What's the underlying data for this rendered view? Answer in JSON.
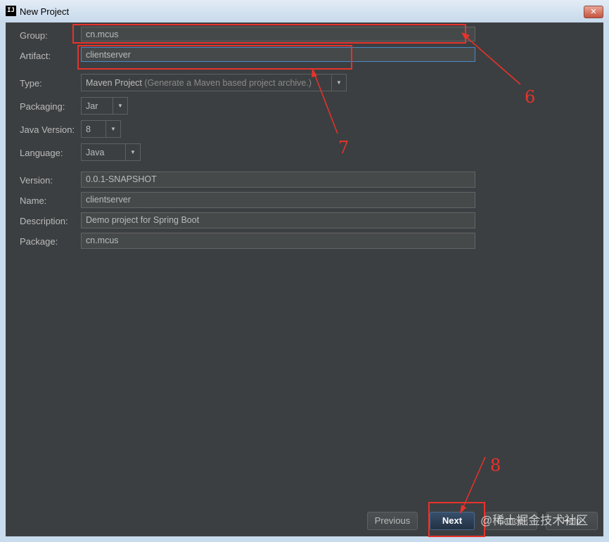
{
  "window": {
    "app_icon_text": "IJ",
    "title": "New Project",
    "close_symbol": "✕"
  },
  "form": {
    "group": {
      "label": "Group:",
      "value": "cn.mcus"
    },
    "artifact": {
      "label": "Artifact:",
      "value": "clientserver"
    },
    "type": {
      "label": "Type:",
      "value": "Maven Project",
      "hint": "(Generate a Maven based project archive.)"
    },
    "packaging": {
      "label": "Packaging:",
      "value": "Jar"
    },
    "java_version": {
      "label": "Java Version:",
      "value": "8"
    },
    "language": {
      "label": "Language:",
      "value": "Java"
    },
    "version": {
      "label": "Version:",
      "value": "0.0.1-SNAPSHOT"
    },
    "name": {
      "label": "Name:",
      "value": "clientserver"
    },
    "description": {
      "label": "Description:",
      "value": "Demo project for Spring Boot"
    },
    "package": {
      "label": "Package:",
      "value": "cn.mcus"
    }
  },
  "buttons": {
    "previous": "Previous",
    "next": "Next",
    "cancel": "Cancel",
    "help": "Help"
  },
  "annotations": [
    "6",
    "7",
    "8"
  ],
  "watermark": "@稀土掘金技术社区",
  "colors": {
    "annotation": "#e8322b",
    "panel": "#3c3f41",
    "field": "#45494a",
    "accent": "#4a88c7"
  }
}
